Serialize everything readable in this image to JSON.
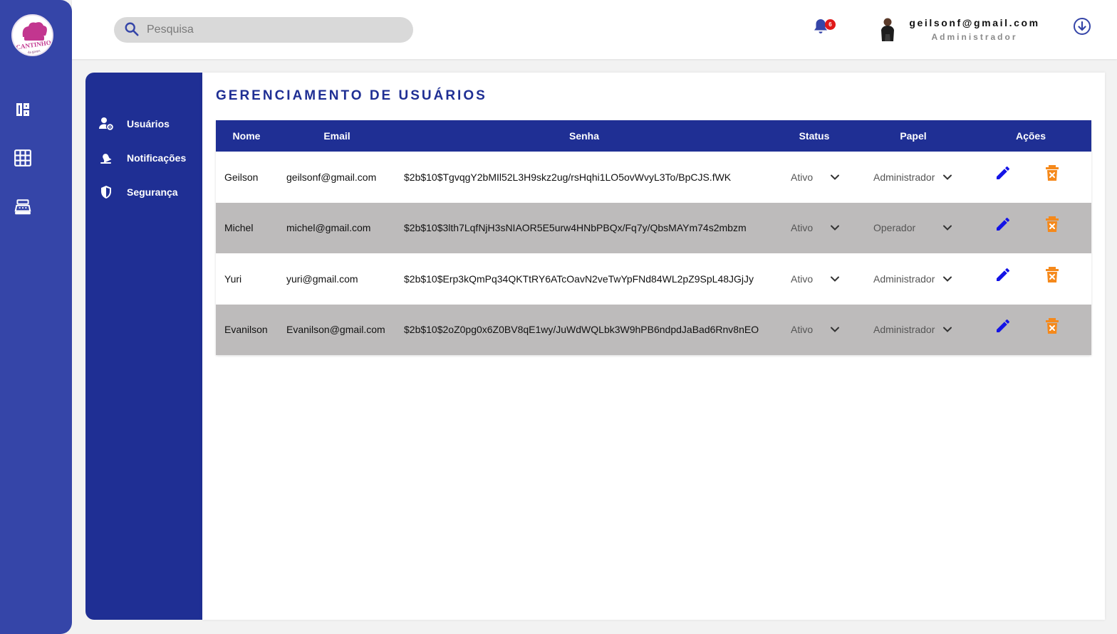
{
  "search": {
    "placeholder": "Pesquisa"
  },
  "notifications": {
    "count": "6"
  },
  "user": {
    "email": "geilsonf@gmail.com",
    "role": "Administrador"
  },
  "logo": {
    "text": "CANTINHO"
  },
  "settings_nav": {
    "items": [
      {
        "label": "Usuários",
        "icon": "user-gear-icon"
      },
      {
        "label": "Notificações",
        "icon": "alarm-icon"
      },
      {
        "label": "Segurança",
        "icon": "shield-icon"
      }
    ]
  },
  "page": {
    "title": "GERENCIAMENTO DE USUÁRIOS"
  },
  "table": {
    "headers": {
      "nome": "Nome",
      "email": "Email",
      "senha": "Senha",
      "status": "Status",
      "papel": "Papel",
      "acoes": "Ações"
    },
    "rows": [
      {
        "nome": "Geilson",
        "email": "geilsonf@gmail.com",
        "senha": "$2b$10$TgvqgY2bMIl52L3H9skz2ug/rsHqhi1LO5ovWvyL3To/BpCJS.fWK",
        "status": "Ativo",
        "papel": "Administrador"
      },
      {
        "nome": "Michel",
        "email": "michel@gmail.com",
        "senha": "$2b$10$3lth7LqfNjH3sNIAOR5E5urw4HNbPBQx/Fq7y/QbsMAYm74s2mbzm",
        "status": "Ativo",
        "papel": "Operador"
      },
      {
        "nome": "Yuri",
        "email": "yuri@gmail.com",
        "senha": "$2b$10$Erp3kQmPq34QKTtRY6ATcOavN2veTwYpFNd84WL2pZ9SpL48JGjJy",
        "status": "Ativo",
        "papel": "Administrador"
      },
      {
        "nome": "Evanilson",
        "email": "Evanilson@gmail.com",
        "senha": "$2b$10$2oZ0pg0x6Z0BV8qE1wy/JuWdWQLbk3W9hPB6ndpdJaBad6Rnv8nEO",
        "status": "Ativo",
        "papel": "Administrador"
      }
    ]
  },
  "colors": {
    "primary": "#1f2f94",
    "rail": "#3545a8",
    "edit": "#1414e6",
    "delete": "#f5891b",
    "alt_row": "#bdbbbb",
    "badge": "#e01818"
  }
}
